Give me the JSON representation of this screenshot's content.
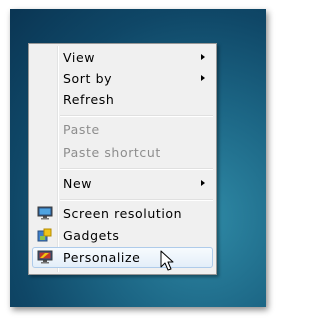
{
  "context_menu": {
    "view": "View",
    "sort_by": "Sort by",
    "refresh": "Refresh",
    "paste": "Paste",
    "paste_shortcut": "Paste shortcut",
    "new": "New",
    "screen_resolution": "Screen resolution",
    "gadgets": "Gadgets",
    "personalize": "Personalize",
    "highlighted_item": "Personalize"
  },
  "icons": {
    "screen_resolution": "monitor-icon",
    "gadgets": "gadgets-icon",
    "personalize": "personalize-monitor-icon",
    "cursor": "mouse-pointer-icon"
  },
  "colors": {
    "menu_background": "#f0f0f0",
    "hover_background": "#e3eef9",
    "hover_border": "#aecbea",
    "disabled_text": "#8d8d8d",
    "desktop": "#1c6685"
  }
}
